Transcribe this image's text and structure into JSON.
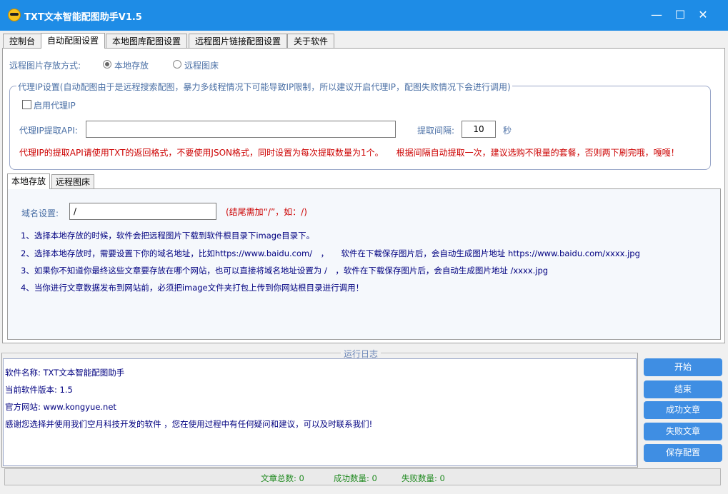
{
  "window": {
    "title": "TXT文本智能配图助手V1.5",
    "minimize": "—",
    "maximize": "☐",
    "close": "✕"
  },
  "tabs": [
    "控制台",
    "自动配图设置",
    "本地图库配图设置",
    "远程图片链接配图设置",
    "关于软件"
  ],
  "storage": {
    "label": "远程图片存放方式:",
    "options": [
      {
        "label": "本地存放",
        "checked": true
      },
      {
        "label": "远程图床",
        "checked": false
      }
    ]
  },
  "proxy": {
    "legend": "代理IP设置(自动配图由于是远程搜索配图，暴力多线程情况下可能导致IP限制，所以建议开启代理IP，配图失败情况下会进行调用)",
    "enable_label": "启用代理IP",
    "api_label": "代理IP提取API:",
    "api_value": "",
    "interval_label": "提取间隔:",
    "interval_value": "10",
    "interval_unit": "秒",
    "warning": "代理IP的提取API请使用TXT的返回格式，不要使用JSON格式，同时设置为每次提取数量为1个。　　根据间隔自动提取一次，建议选购不限量的套餐，否则两下刷完哦，嘎嘎！"
  },
  "subtabs": [
    "本地存放",
    "远程图床"
  ],
  "local": {
    "domain_label": "域名设置:",
    "domain_value": "/",
    "domain_hint": "(结尾需加“/”，如：/)",
    "instructions": [
      "1、选择本地存放的时候，软件会把远程图片下载到软件根目录下image目录下。",
      "2、选择本地存放时，需要设置下你的域名地址，比如https://www.baidu.com/　，　　软件在下载保存图片后，会自动生成图片地址 https://www.baidu.com/xxxx.jpg",
      "3、如果你不知道你最终这些文章要存放在哪个网站，也可以直接将域名地址设置为 /　，软件在下载保存图片后，会自动生成图片地址 /xxxx.jpg",
      "4、当你进行文章数据发布到网站前，必须把image文件夹打包上传到你网站根目录进行调用！"
    ]
  },
  "log": {
    "title": "运行日志",
    "lines": [
      "软件名称: TXT文本智能配图助手",
      "当前软件版本: 1.5",
      "官方网站: www.kongyue.net",
      "感谢您选择并使用我们空月科技开发的软件 ，您在使用过程中有任何疑问和建议，可以及时联系我们!"
    ]
  },
  "buttons": [
    "开始",
    "结束",
    "成功文章",
    "失败文章",
    "保存配置"
  ],
  "status": {
    "total_label": "文章总数: 0",
    "success_label": "成功数量: 0",
    "fail_label": "失败数量: 0"
  },
  "colors": {
    "titlebar": "#1e8ce6",
    "button": "#3f8ee3",
    "warning": "#cc0000",
    "status": "#228b22"
  }
}
